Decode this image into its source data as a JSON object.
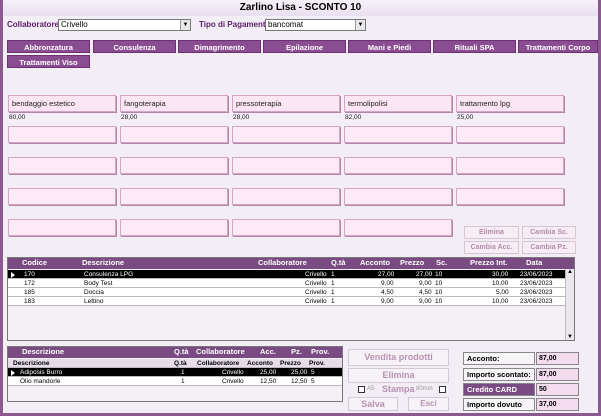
{
  "window": {
    "title": "Zarlino Lisa - SCONTO 10"
  },
  "filters": {
    "collaboratore_label": "Collaboratore",
    "collaboratore_value": "Crivello",
    "pagamento_label": "Tipo di Pagamento",
    "pagamento_value": "bancomat"
  },
  "tabs": [
    "Abbronzatura",
    "Consulenza",
    "Dimagrimento",
    "Epilazione",
    "Mani e Piedi",
    "Rituali SPA",
    "Trattamenti Corpo",
    "Trattamenti Viso"
  ],
  "services": [
    {
      "name": "bendaggio estetico",
      "price": "80,00"
    },
    {
      "name": "fangoterapia",
      "price": "28,00"
    },
    {
      "name": "pressoterapia",
      "price": "28,00"
    },
    {
      "name": "termolipolisi",
      "price": "82,00"
    },
    {
      "name": "trattamento lpg",
      "price": "25,00"
    }
  ],
  "actions": {
    "elimina": "Elimina",
    "cambia_sc": "Cambia Sc.",
    "cambia_acc": "Cambia Acc.",
    "cambia_pz": "Cambia Pz."
  },
  "main_grid": {
    "headers": [
      "Codice",
      "Descrizione",
      "Collaboratore",
      "Q.tà",
      "Acconto",
      "Prezzo",
      "Sc.",
      "Prezzo Int.",
      "Data"
    ],
    "rows": [
      [
        "170",
        "Consulenza LPG",
        "Crivello",
        "1",
        "27,00",
        "27,00",
        "10",
        "30,00",
        "23/06/2023"
      ],
      [
        "172",
        "Body Test",
        "Crivello",
        "1",
        "9,00",
        "9,00",
        "10",
        "10,00",
        "23/06/2023"
      ],
      [
        "185",
        "Doccia",
        "Crivello",
        "1",
        "4,50",
        "4,50",
        "10",
        "5,00",
        "23/06/2023"
      ],
      [
        "183",
        "Lettino",
        "Crivello",
        "1",
        "9,00",
        "9,00",
        "10",
        "10,00",
        "23/06/2023"
      ]
    ]
  },
  "product_grid": {
    "headers": [
      "Descrizione",
      "Q.tà",
      "Collaboratore",
      "Acc.",
      "Pz.",
      "Prov."
    ],
    "subheaders": [
      "Descrizione",
      "Q.tà",
      "Collaboratore",
      "Acconto",
      "Prezzo",
      "Prov."
    ],
    "rows": [
      [
        "Adiposis Burro",
        "1",
        "Crivello",
        "25,00",
        "25,00",
        "5"
      ],
      [
        "Olio mandorle",
        "1",
        "Crivello",
        "12,50",
        "12,50",
        "5"
      ]
    ]
  },
  "bottom": {
    "vendita": "Vendita prodotti",
    "elimina": "Elimina",
    "a5": "A5",
    "stampa": "Stampa",
    "mm80": "80mm",
    "salva": "Salva",
    "esci": "Esci"
  },
  "summary": {
    "acconto_label": "Acconto:",
    "acconto_value": "87,00",
    "importo_scontato_label": "Importo scontato:",
    "importo_scontato_value": "87,00",
    "credito_label": "Credito CARD",
    "credito_value": "50",
    "importo_dovuto_label": "Importo dovuto",
    "importo_dovuto_value": "37,00"
  }
}
